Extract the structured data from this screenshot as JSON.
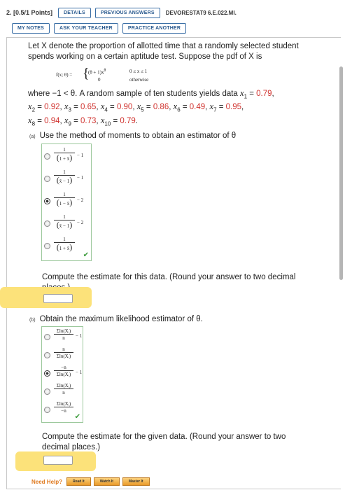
{
  "header": {
    "question_number": "2.",
    "points": "[0.5/1 Points]",
    "details_label": "DETAILS",
    "previous_answers_label": "PREVIOUS ANSWERS",
    "question_id": "DEVORESTAT9 6.E.022.MI.",
    "my_notes_label": "MY NOTES",
    "ask_teacher_label": "ASK YOUR TEACHER",
    "practice_label": "PRACTICE ANOTHER"
  },
  "problem": {
    "intro_line1": "Let X denote the proportion of allotted time that a randomly selected student",
    "intro_line2": "spends working on a certain aptitude test. Suppose the pdf of X is",
    "pdf_lhs": "f(x; θ) =",
    "pdf_case1": "(θ + 1)x",
    "pdf_case1_exp": "θ",
    "pdf_case1_range": "0 ≤ x ≤ 1",
    "pdf_case2": "0",
    "pdf_case2_range": "otherwise",
    "where_text": "where −1 < θ. A random sample of ten students yields data",
    "data": [
      "0.79",
      "0.92",
      "0.65",
      "0.90",
      "0.86",
      "0.49",
      "0.95",
      "0.94",
      "0.73",
      "0.79"
    ]
  },
  "part_a": {
    "label": "(a)",
    "question": "Use the method of moments to obtain an estimator of θ",
    "options": [
      {
        "num": "1",
        "den": "1 + x̄",
        "tail": "− 1",
        "selected": false
      },
      {
        "num": "1",
        "den": "x̄ − 1",
        "tail": "− 1",
        "selected": false
      },
      {
        "num": "1",
        "den": "1 − x̄",
        "tail": "− 2",
        "selected": true
      },
      {
        "num": "1",
        "den": "x̄ − 1",
        "tail": "− 2",
        "selected": false
      },
      {
        "num": "1",
        "den": "1 + x̄",
        "tail": "",
        "selected": false
      }
    ],
    "compute_line1": "Compute the estimate for this data. (Round your answer to two decimal",
    "compute_line2": "places.)"
  },
  "part_b": {
    "label": "(b)",
    "question": "Obtain the maximum likelihood estimator of θ.",
    "options": [
      {
        "num": "Σln(Xᵢ)",
        "den": "n",
        "tail": "− 1",
        "selected": false
      },
      {
        "num": "n",
        "den": "Σln(Xᵢ)",
        "tail": "",
        "selected": false
      },
      {
        "num": "−n",
        "den": "Σln(Xᵢ)",
        "tail": "− 1",
        "selected": true
      },
      {
        "num": "Σln(Xᵢ)",
        "den": "n",
        "tail": "",
        "selected": false
      },
      {
        "num": "Σln(Xᵢ)",
        "den": "−n",
        "tail": "",
        "selected": false
      }
    ],
    "compute_line1": "Compute the estimate for the given data. (Round your answer to two",
    "compute_line2": "decimal places.)"
  },
  "help": {
    "label": "Need Help?",
    "read_label": "Read It",
    "watch_label": "Watch It",
    "master_label": "Master It"
  },
  "colors": {
    "accent": "#3a6ea5",
    "wrong": "#d0322e",
    "highlight": "#fce27a",
    "help": "#e07a1f"
  },
  "icons": {
    "correct": "checkmark-icon"
  }
}
